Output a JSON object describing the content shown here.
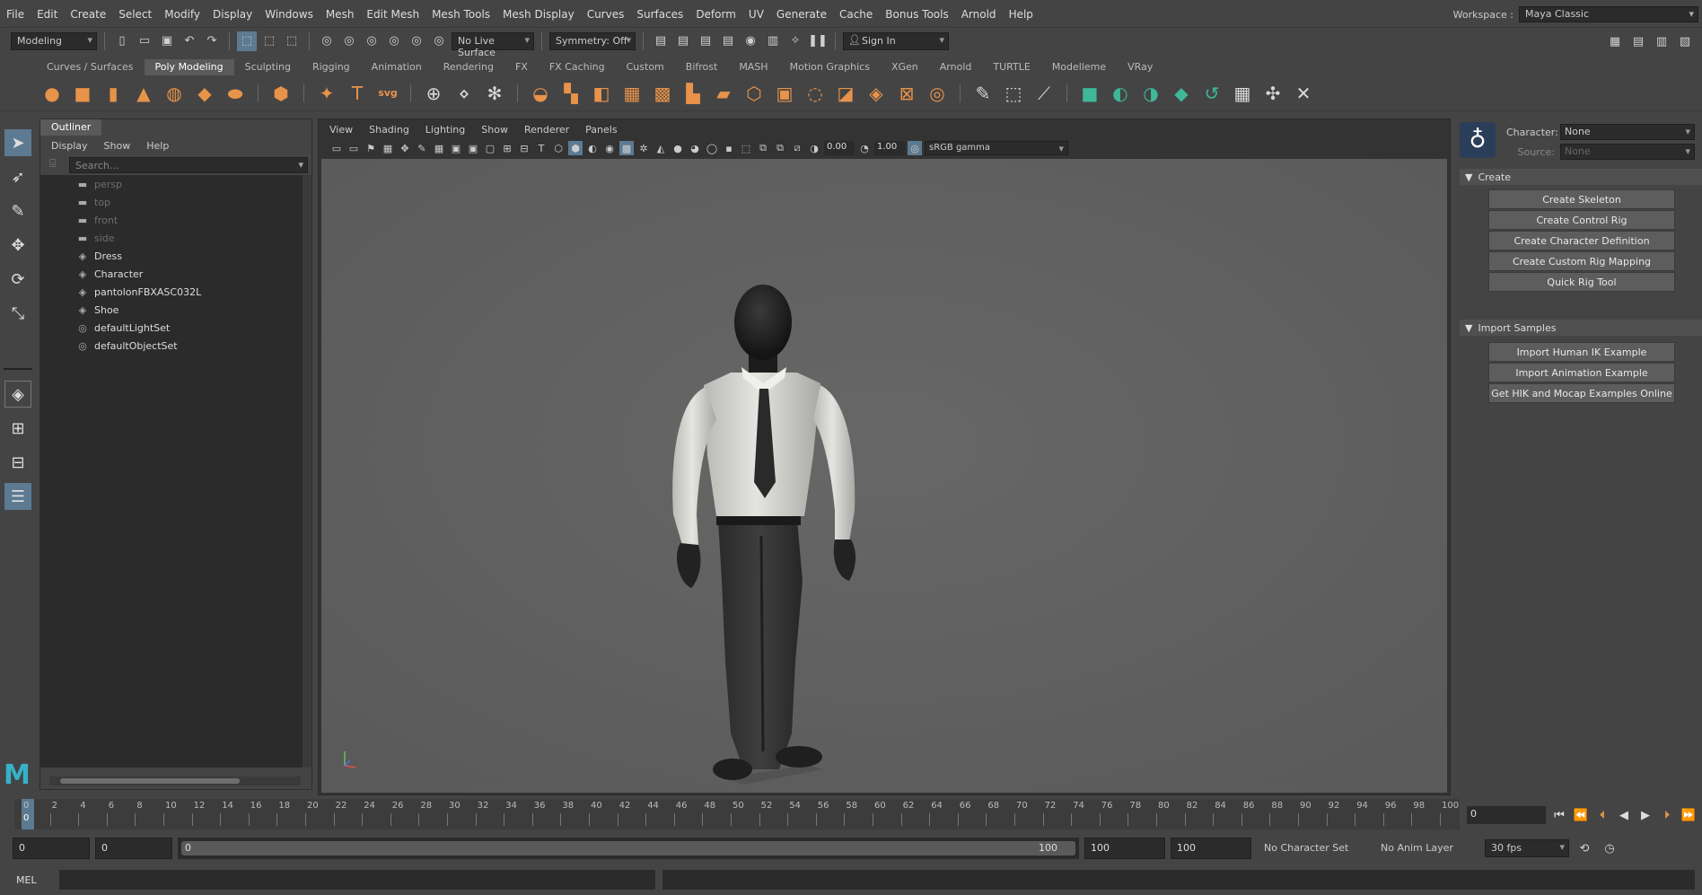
{
  "menu": [
    "File",
    "Edit",
    "Create",
    "Select",
    "Modify",
    "Display",
    "Windows",
    "Mesh",
    "Edit Mesh",
    "Mesh Tools",
    "Mesh Display",
    "Curves",
    "Surfaces",
    "Deform",
    "UV",
    "Generate",
    "Cache",
    "Bonus Tools",
    "Arnold",
    "Help"
  ],
  "workspace": {
    "label": "Workspace :",
    "value": "Maya Classic"
  },
  "status": {
    "menuset": "Modeling",
    "live_surface": "No Live Surface",
    "symmetry": "Symmetry: Off",
    "sign_in": "Sign In"
  },
  "shelf_tabs": [
    "Curves / Surfaces",
    "Poly Modeling",
    "Sculpting",
    "Rigging",
    "Animation",
    "Rendering",
    "FX",
    "FX Caching",
    "Custom",
    "Bifrost",
    "MASH",
    "Motion Graphics",
    "XGen",
    "Arnold",
    "TURTLE",
    "Modelleme",
    "VRay"
  ],
  "shelf_active": "Poly Modeling",
  "outliner": {
    "tab": "Outliner",
    "menu": [
      "Display",
      "Show",
      "Help"
    ],
    "search_placeholder": "Search...",
    "items": [
      {
        "label": "persp",
        "type": "camera",
        "dim": true
      },
      {
        "label": "top",
        "type": "camera",
        "dim": true
      },
      {
        "label": "front",
        "type": "camera",
        "dim": true
      },
      {
        "label": "side",
        "type": "camera",
        "dim": true
      },
      {
        "label": "Dress",
        "type": "group",
        "dim": false
      },
      {
        "label": "Character",
        "type": "group",
        "dim": false
      },
      {
        "label": "pantolonFBXASC032L",
        "type": "group",
        "dim": false
      },
      {
        "label": "Shoe",
        "type": "group",
        "dim": false
      },
      {
        "label": "defaultLightSet",
        "type": "set",
        "dim": false
      },
      {
        "label": "defaultObjectSet",
        "type": "set",
        "dim": false
      }
    ]
  },
  "viewport": {
    "menu": [
      "View",
      "Shading",
      "Lighting",
      "Show",
      "Renderer",
      "Panels"
    ],
    "exposure": "0.00",
    "gamma": "1.00",
    "color_space": "sRGB gamma"
  },
  "hik": {
    "character_label": "Character:",
    "character_value": "None",
    "source_label": "Source:",
    "source_value": "None",
    "create_section": "Create",
    "create_buttons": [
      "Create Skeleton",
      "Create Control Rig",
      "Create Character Definition",
      "Create Custom Rig Mapping",
      "Quick Rig Tool"
    ],
    "import_section": "Import Samples",
    "import_buttons": [
      "Import Human IK Example",
      "Import Animation Example",
      "Get HIK and Mocap Examples Online"
    ]
  },
  "timeline": {
    "ticks": [
      "0",
      "2",
      "4",
      "6",
      "8",
      "10",
      "12",
      "14",
      "16",
      "18",
      "20",
      "22",
      "24",
      "26",
      "28",
      "30",
      "32",
      "34",
      "36",
      "38",
      "40",
      "42",
      "44",
      "46",
      "48",
      "50",
      "52",
      "54",
      "56",
      "58",
      "60",
      "62",
      "64",
      "66",
      "68",
      "70",
      "72",
      "74",
      "76",
      "78",
      "80",
      "82",
      "84",
      "86",
      "88",
      "90",
      "92",
      "94",
      "96",
      "98",
      "100"
    ],
    "current_frame": "0",
    "current_frame_field": "0"
  },
  "range": {
    "start": "0",
    "anim_start": "0",
    "range_left": "0",
    "range_right": "100",
    "anim_end": "100",
    "end": "100",
    "character_set": "No Character Set",
    "anim_layer": "No Anim Layer",
    "fps": "30 fps"
  },
  "cmd": {
    "mel": "MEL"
  },
  "colors": {
    "accent": "#5c7a92",
    "shelf_orange": "#e8934a",
    "shelf_green": "#3fb89a",
    "maya_logo": "#35b2c6"
  }
}
